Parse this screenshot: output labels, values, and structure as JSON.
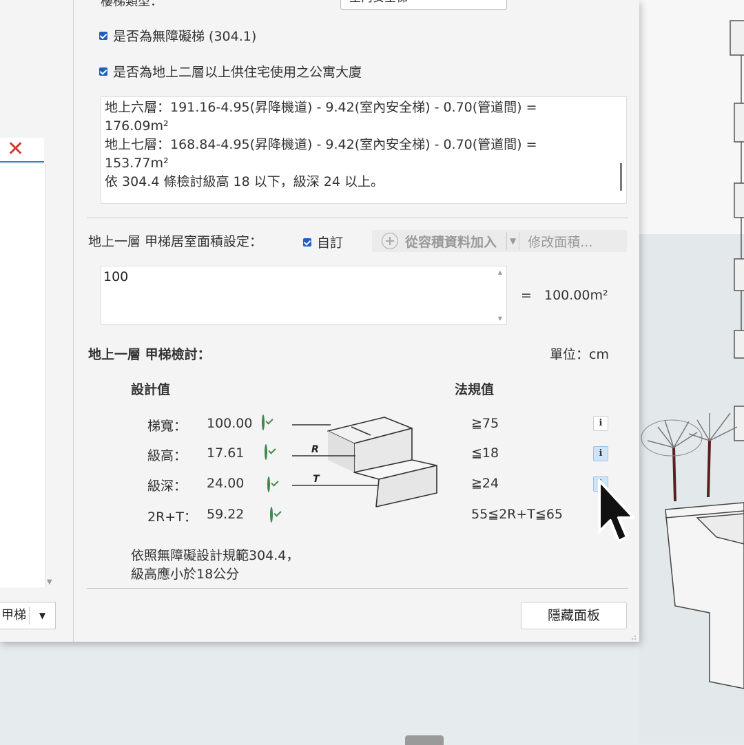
{
  "top": {
    "partial_label": "樓梯類型：",
    "select_value": "室內安全梯"
  },
  "checkboxes": [
    {
      "label": "是否為無障礙梯 (304.1)",
      "checked": true
    },
    {
      "label": "是否為地上二層以上供住宅使用之公寓大廈",
      "checked": true
    }
  ],
  "notes_lines": [
    "地上六層：191.16-4.95(昇降機道) - 9.42(室內安全梯) - 0.70(管道間) =",
    "176.09m²",
    "地上七層：168.84-4.95(昇降機道) - 9.42(室內安全梯) - 0.70(管道間) =",
    "153.77m²",
    "依 304.4 條檢討級高 18 以下，級深 24 以上。"
  ],
  "area_setting": {
    "label": "地上一層 甲梯居室面積設定：",
    "custom_label": "自訂",
    "custom_checked": true,
    "add_from_button": "從容積資料加入",
    "modify_button": "修改面積...",
    "input_value": "100",
    "equals": "=",
    "result": "100.00m²"
  },
  "review": {
    "title": "地上一層 甲梯檢討：",
    "unit": "單位：cm",
    "col_design": "設計值",
    "col_code": "法規值",
    "rows": [
      {
        "name": "梯寬：",
        "value": "100.00",
        "ok": true,
        "code": "≧75"
      },
      {
        "name": "級高：",
        "value": "17.61",
        "ok": true,
        "code": "≦18"
      },
      {
        "name": "級深：",
        "value": "24.00",
        "ok": true,
        "code": "≧24"
      },
      {
        "name": "2R+T：",
        "value": "59.22",
        "ok": true,
        "code": "55≦2R+T≦65"
      }
    ],
    "diagram_labels": {
      "r": "R",
      "t": "T"
    },
    "info_glyph": "i",
    "note_lines": [
      "依照無障礙設計規範304.4，",
      "級高應小於18公分"
    ]
  },
  "left_pane": {
    "dropdown_label": "甲梯"
  },
  "hide_button": "隱藏面板",
  "colors": {
    "checkbox": "#1e5fbf",
    "ok_icon": "#3d8a4a",
    "error_icon": "#d0392b",
    "info_active": "#cfe4f7"
  }
}
